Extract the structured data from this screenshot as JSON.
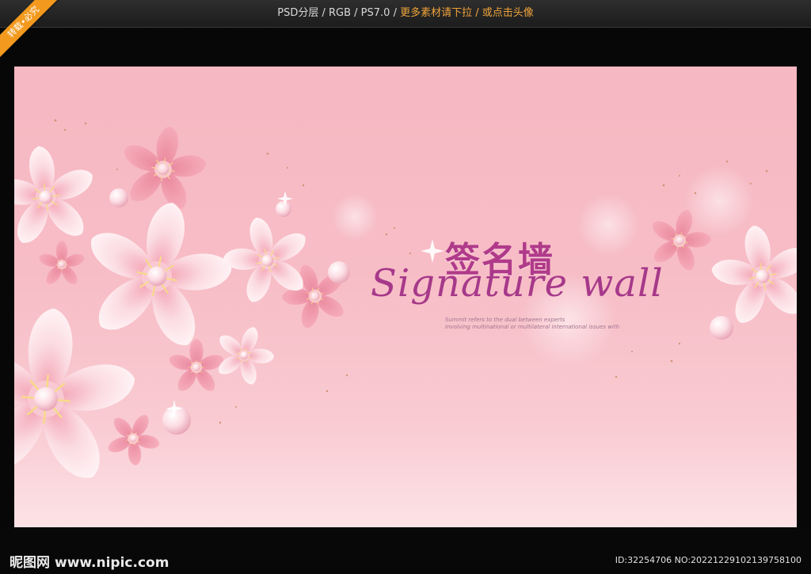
{
  "topbar": {
    "format_text": "PSD分层 / RGB / PS7.0 / ",
    "promo_text": "更多素材请下拉 / 或点击头像"
  },
  "ribbon": {
    "label": "转载•必究"
  },
  "poster": {
    "title_cn": "签名墙",
    "title_en": "Signature wall",
    "subtitle_line1": "Summit refers to the dual between experts",
    "subtitle_line2": "Involving multinational or multilateral international issues with"
  },
  "footer": {
    "logo_cn": "昵图网",
    "logo_url": "www.nipic.com",
    "id_text": "ID:32254706 NO:20221229102139758100"
  },
  "colors": {
    "accent_title": "#b03a8a",
    "ribbon": "#f39a1e",
    "poster_pink": "#f7bdc6"
  }
}
